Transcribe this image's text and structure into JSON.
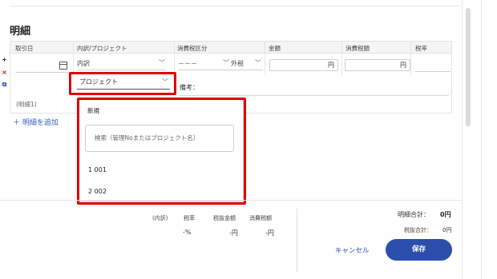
{
  "section": {
    "title": "明細"
  },
  "table": {
    "headers": [
      "取引日",
      "内訳/プロジェクト",
      "消費税区分",
      "金額",
      "消費税額",
      "税率"
    ],
    "row": {
      "breakdown_select": "内訳",
      "tax_category": "－－－",
      "tax_type": "外税",
      "amount_unit": "円",
      "tax_amount_unit": "円",
      "project_select": "プロジェクト",
      "biko_label": "備考：",
      "row_label": "(明細1)"
    },
    "side_buttons": [
      "+",
      "×",
      "⧉"
    ],
    "add_line": "＋ 明細を追加"
  },
  "dropdown": {
    "new_label": "新規",
    "search_placeholder": "検索（管理Noまたはプロジェクト名）",
    "items": [
      "1  001",
      "2  002"
    ]
  },
  "footer": {
    "summary_headers": [
      "(内訳)",
      "税率",
      "税抜金額",
      "消費税額"
    ],
    "summary_values": [
      "-%",
      "-円",
      "-円"
    ],
    "total_label": "明細合計：",
    "total_value": "0円",
    "tax_excluded_label": "税抜合計：",
    "tax_excluded_value": "0円",
    "cancel_label": "キャンセル",
    "save_label": "保存"
  },
  "colors": {
    "highlight": "#e00000",
    "primary": "#2c4fae",
    "link": "#3a5bbf"
  }
}
